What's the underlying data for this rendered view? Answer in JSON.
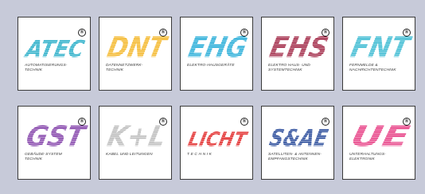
{
  "tiles": [
    {
      "logo": "ATEC",
      "color": "#19a8c4",
      "caption": "AUTOMATISIERUNGS-\nTECHNIK",
      "reg": "®"
    },
    {
      "logo": "DNT",
      "color": "#f3b21b",
      "caption": "DATENNETZWERK-\nTECHNIK",
      "reg": "®"
    },
    {
      "logo": "EHG",
      "color": "#1aa8d6",
      "caption": "ELEKTRO-HAUSGERÄTE",
      "reg": "®"
    },
    {
      "logo": "EHS",
      "color": "#9c1c3c",
      "caption": "ELEKTRO HAUS- UND\nSYSTEMTECHNIK",
      "reg": "®"
    },
    {
      "logo": "FNT",
      "color": "#2fb6cf",
      "caption": "FERNMELDE &\nNACHRICHTENTECHNIK",
      "reg": "®"
    },
    {
      "logo": "GST",
      "color": "#7e3aa6",
      "caption": "GEBÄUDE-SYSTEM\nTECHNIK",
      "reg": "®"
    },
    {
      "logo": "K+L",
      "color": "#b9b9b9",
      "caption": "KABEL UND LEITUNGEN",
      "reg": "®"
    },
    {
      "logo": "LICHT",
      "color": "#e01b1b",
      "caption": "T E C H N I K",
      "reg": "®"
    },
    {
      "logo": "S&AE",
      "color": "#1b3f93",
      "caption": "SATELLITEN- & ANTENNEN-\nEMPFANGSTECHNIK",
      "reg": "®"
    },
    {
      "logo": "UE",
      "color": "#e6367f",
      "caption": "UNTERHALTUNGS-\nELEKTRONIK",
      "reg": "®"
    }
  ]
}
